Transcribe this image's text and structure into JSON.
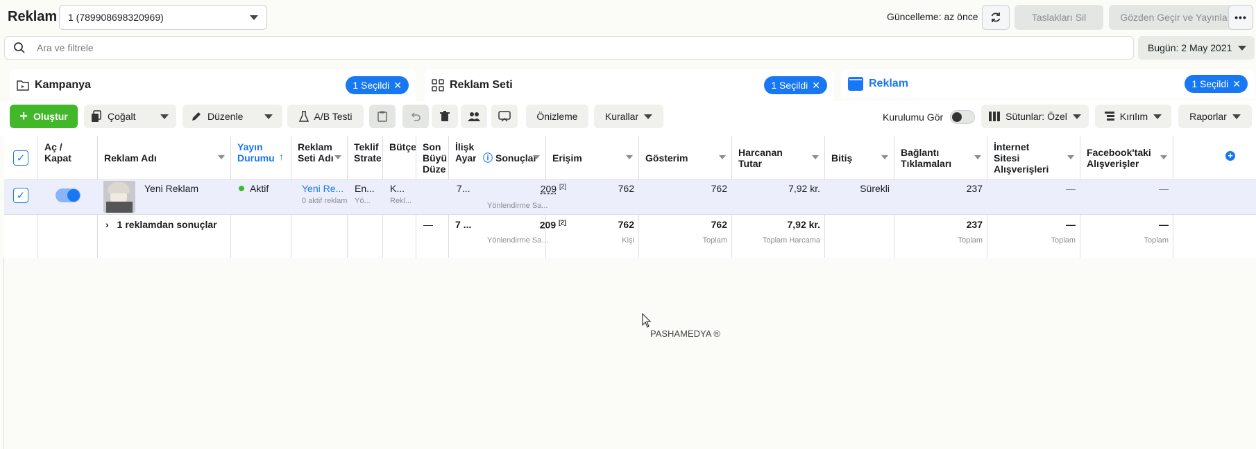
{
  "header": {
    "title": "Reklam",
    "account": "1 (789908698320969)",
    "update_status": "Güncelleme: az önce",
    "delete_drafts": "Taslakları Sil",
    "review_publish": "Gözden Geçir ve Yayınla"
  },
  "search": {
    "placeholder": "Ara ve filtrele"
  },
  "date_range": "Bugün: 2 May 2021",
  "levels": {
    "campaign": {
      "label": "Kampanya",
      "chip": "1 Seçildi"
    },
    "adset": {
      "label": "Reklam Seti",
      "chip": "1 Seçildi"
    },
    "ad": {
      "label": "Reklam",
      "chip": "1 Seçildi"
    }
  },
  "toolbar": {
    "create": "Oluştur",
    "duplicate": "Çoğalt",
    "edit": "Düzenle",
    "ab_test": "A/B Testi",
    "preview": "Önizleme",
    "rules": "Kurallar",
    "setup_toggle": "Kurulumu Gör",
    "columns": "Sütunlar: Özel",
    "breakdown": "Kırılım",
    "reports": "Raporlar"
  },
  "table": {
    "headers": {
      "toggle": "Aç / Kapat",
      "ad_name": "Reklam Adı",
      "delivery": "Yayın Durumu",
      "adset_name": "Reklam Seti Adı",
      "bid": "Teklif Strate",
      "budget": "Bütçe",
      "last_edit": "Son Büyü Düze",
      "attribution": "İlişk Ayar",
      "results": "Sonuçlar",
      "reach": "Erişim",
      "impressions": "Gösterim",
      "spent": "Harcanan Tutar",
      "ends": "Bitiş",
      "link_clicks": "Bağlantı Tıklamaları",
      "web_purchases": "İnternet Sitesi Alışverişleri",
      "fb_purchases": "Facebook'taki Alışverişler"
    },
    "row": {
      "ad_name": "Yeni Reklam",
      "delivery": "Aktif",
      "adset_name": "Yeni Re...",
      "adset_sub": "0 aktif reklam",
      "bid": "En...",
      "bid_sub": "Rekl...",
      "bid_sub2": "Yö...",
      "budget": "K...",
      "budget_sub": "Rekl...",
      "attribution": "7...",
      "results": "209",
      "results_note": "[2]",
      "results_sub": "Yönlendirme Sa...",
      "reach": "762",
      "impressions": "762",
      "spent": "7,92 kr.",
      "ends": "Sürekli",
      "link_clicks": "237",
      "web_purchases": "—",
      "fb_purchases": "—"
    },
    "summary": {
      "label": "1 reklamdan sonuçlar",
      "last_edit": "—",
      "attribution": "7 ...",
      "results": "209",
      "results_note": "[2]",
      "results_sub": "Yönlendirme Sayf...",
      "reach": "762",
      "reach_sub": "Kişi",
      "impressions": "762",
      "impressions_sub": "Toplam",
      "spent": "7,92 kr.",
      "spent_sub": "Toplam Harcama",
      "link_clicks": "237",
      "link_clicks_sub": "Toplam",
      "web_purchases": "—",
      "web_purchases_sub": "Toplam",
      "fb_purchases": "—",
      "fb_purchases_sub": "Toplam"
    }
  },
  "watermark": "PASHAMEDYA ®",
  "colors": {
    "accent": "#1877f2",
    "create": "#42b72a",
    "active": "#42b72a"
  }
}
